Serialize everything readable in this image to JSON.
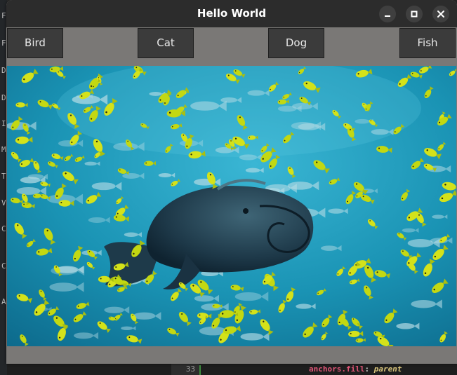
{
  "window": {
    "title": "Hello World"
  },
  "buttons": {
    "bird": "Bird",
    "cat": "Cat",
    "dog": "Dog",
    "fish": "Fish"
  },
  "window_controls": [
    "minimize-icon",
    "maximize-icon",
    "close-icon"
  ],
  "image": {
    "subject": "fish"
  },
  "editor": {
    "left_gutter_chars": [
      "F",
      "F",
      "D",
      "D",
      "I",
      "M",
      "T",
      "V",
      "C",
      "C",
      "A"
    ],
    "line_number": "33",
    "code_property": "anchors.fill",
    "code_colon": ":",
    "code_value": "parent"
  },
  "colors": {
    "titlebar": "#2c2c2c",
    "window_bg": "#7a7876",
    "button_bg": "#3b3b3b",
    "water": "#1b8fae",
    "school_fish": "#d4e21a"
  }
}
